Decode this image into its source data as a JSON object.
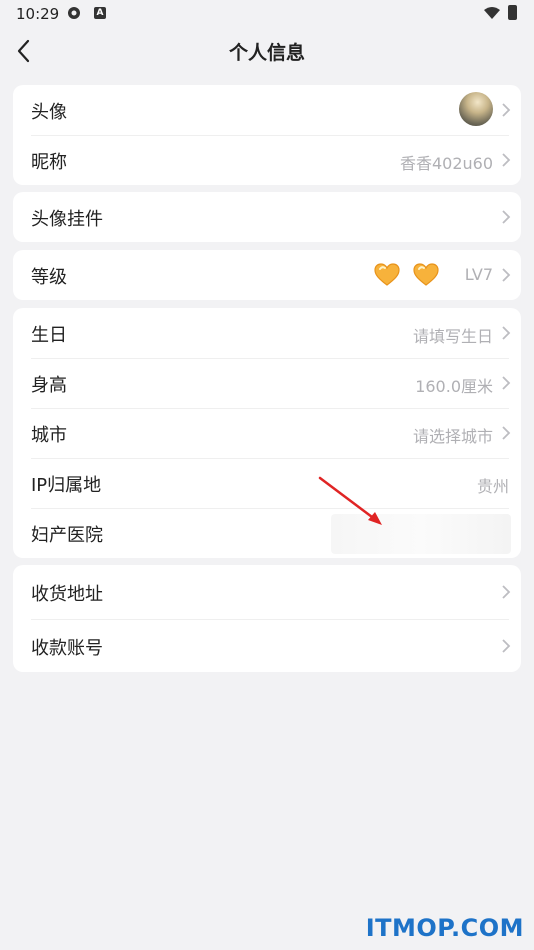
{
  "status_bar": {
    "time": "10:29"
  },
  "header": {
    "title": "个人信息"
  },
  "cards": {
    "profile": {
      "avatar_label": "头像",
      "nickname_label": "昵称",
      "nickname_value": "香香402u60"
    },
    "pendant": {
      "label": "头像挂件"
    },
    "level": {
      "label": "等级",
      "value": "LV7"
    },
    "details": {
      "birthday_label": "生日",
      "birthday_value": "请填写生日",
      "height_label": "身高",
      "height_value": "160.0厘米",
      "city_label": "城市",
      "city_value": "请选择城市",
      "ip_label": "IP归属地",
      "ip_value": "贵州",
      "hospital_label": "妇产医院"
    },
    "account": {
      "address_label": "收货地址",
      "payee_label": "收款账号"
    }
  },
  "icons": [
    "back-icon",
    "chevron-right-icon",
    "heart-icon",
    "wifi-icon",
    "battery-icon"
  ],
  "colors": {
    "accent_heart": "#f5a623",
    "watermark": "#1e73c8",
    "arrow": "#e02424"
  },
  "watermark": "ITMOP.COM"
}
